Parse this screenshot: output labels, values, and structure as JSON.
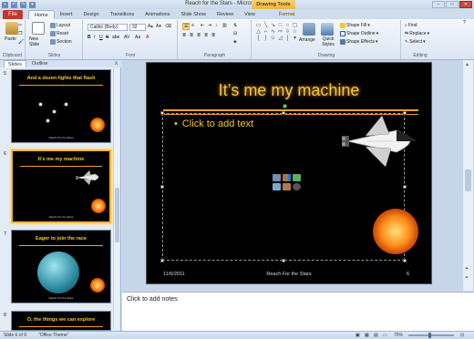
{
  "window": {
    "title": "Reach for the Stars - Microsoft PowerPoint",
    "contextual_tab_group": "Drawing Tools",
    "controls": [
      "–",
      "□",
      "✕"
    ]
  },
  "qat": [
    "save-icon",
    "undo-icon",
    "redo-icon",
    "customize-icon"
  ],
  "tabs": [
    {
      "label": "File"
    },
    {
      "label": "Home",
      "active": true
    },
    {
      "label": "Insert"
    },
    {
      "label": "Design"
    },
    {
      "label": "Transitions"
    },
    {
      "label": "Animations"
    },
    {
      "label": "Slide Show"
    },
    {
      "label": "Review"
    },
    {
      "label": "View"
    },
    {
      "label": "Format"
    }
  ],
  "ribbon": {
    "clipboard": {
      "label": "Clipboard",
      "paste": "Paste"
    },
    "slides": {
      "label": "Slides",
      "new_slide": "New Slide",
      "layout": "Layout",
      "reset": "Reset",
      "section": "Section"
    },
    "font": {
      "label": "Font",
      "font_name": "Calibri (Body)",
      "font_size": "32",
      "bold": "B",
      "italic": "I",
      "underline": "U",
      "strike": "S",
      "shadow": "abe",
      "spacing": "AV",
      "case": "Aa",
      "color": "A"
    },
    "paragraph": {
      "label": "Paragraph"
    },
    "drawing": {
      "label": "Drawing",
      "arrange": "Arrange",
      "quick_styles": "Quick Styles",
      "shape_fill": "Shape Fill",
      "shape_outline": "Shape Outline",
      "shape_effects": "Shape Effects"
    },
    "editing": {
      "label": "Editing",
      "find": "Find",
      "replace": "Replace",
      "select": "Select"
    }
  },
  "panel": {
    "tabs": [
      "Slides",
      "Outline"
    ],
    "close": "x",
    "thumbnails": [
      {
        "num": "5",
        "title": "And a dozen lights that flash",
        "footer": "Reach For the Stars"
      },
      {
        "num": "6",
        "title": "It's me my machine",
        "footer": "Reach For the Stars",
        "selected": true
      },
      {
        "num": "7",
        "title": "Eager to join the race",
        "footer": "Reach For the Stars"
      },
      {
        "num": "8",
        "title": "O, the things we can explore"
      }
    ]
  },
  "slide": {
    "title": "It’s me my machine",
    "bullet": "Click to add text",
    "date": "11/6/2011",
    "footer": "Reach For the Stars",
    "number": "6"
  },
  "notes": {
    "placeholder": "Click to add notes"
  },
  "status": {
    "slide_info": "Slide 6 of 9",
    "theme": "\"Office Theme\"",
    "zoom": "75%"
  },
  "colors": {
    "title_gold": "#f2c63a",
    "rule_orange": "#f0a030",
    "file_tab": "#c0392b",
    "contextual_tab": "#f0b53c"
  }
}
